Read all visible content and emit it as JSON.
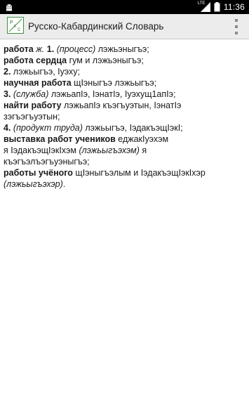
{
  "status_bar": {
    "network": "LTE",
    "time": "11:36"
  },
  "app_bar": {
    "title": "Русско-Кабардинский Словарь",
    "logo_text": "РКС",
    "menu_icon": "overflow-menu-icon"
  },
  "entry": [
    [
      {
        "t": "работа",
        "s": "b"
      },
      {
        "t": " ",
        "s": ""
      },
      {
        "t": "ж.",
        "s": "i"
      },
      {
        "t": " ",
        "s": ""
      },
      {
        "t": "1.",
        "s": "b"
      },
      {
        "t": " ",
        "s": ""
      },
      {
        "t": "(процесс)",
        "s": "i"
      },
      {
        "t": " лэжьэныгъэ;",
        "s": ""
      }
    ],
    [
      {
        "t": "работа сердца",
        "s": "b"
      },
      {
        "t": " гум и лэжьэныгъэ;",
        "s": ""
      }
    ],
    [
      {
        "t": "2.",
        "s": "b"
      },
      {
        "t": " лэжьыгъэ, Iуэху;",
        "s": ""
      }
    ],
    [
      {
        "t": "научная работа",
        "s": "b"
      },
      {
        "t": " щIэныгъэ лэжьыгъэ;",
        "s": ""
      }
    ],
    [
      {
        "t": "3.",
        "s": "b"
      },
      {
        "t": " ",
        "s": ""
      },
      {
        "t": "(служба)",
        "s": "i"
      },
      {
        "t": " лэжьапIэ, IэнатIэ, Iуэхущ1апIэ;",
        "s": ""
      }
    ],
    [
      {
        "t": "найти работу",
        "s": "b"
      },
      {
        "t": " лэжьапIэ къэгъуэтын, IэнатIэ",
        "s": ""
      }
    ],
    [
      {
        "t": "зэгъэгъуэтын;",
        "s": ""
      }
    ],
    [
      {
        "t": "4.",
        "s": "b"
      },
      {
        "t": " ",
        "s": ""
      },
      {
        "t": "(продукт труда)",
        "s": "i"
      },
      {
        "t": " лэжьыгъэ, IэдакъэщIэкI;",
        "s": ""
      }
    ],
    [
      {
        "t": "выставка работ учеников",
        "s": "b"
      },
      {
        "t": " еджакIуэхэм",
        "s": ""
      }
    ],
    [
      {
        "t": "я IэдакъэщIэкIхэм ",
        "s": ""
      },
      {
        "t": "(лэжьыгъэхэм)",
        "s": "i"
      },
      {
        "t": " я",
        "s": ""
      }
    ],
    [
      {
        "t": "къэгъэлъэгъуэныгъэ;",
        "s": ""
      }
    ],
    [
      {
        "t": "работы учёного",
        "s": "b"
      },
      {
        "t": " щIэныгъэлым и IэдакъэщIэкIхэр",
        "s": ""
      }
    ],
    [
      {
        "t": "(лэжьыгъэхэр)",
        "s": "i"
      },
      {
        "t": ".",
        "s": ""
      }
    ]
  ]
}
